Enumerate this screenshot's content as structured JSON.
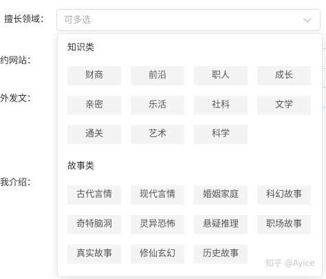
{
  "form": {
    "labels": [
      "擅长领域：",
      "约网站：",
      "外发文：",
      "我介绍："
    ],
    "select": {
      "placeholder": "可多选"
    }
  },
  "dropdown": {
    "groups": [
      {
        "title": "知识类",
        "tags": [
          "财商",
          "前沿",
          "职人",
          "成长",
          "亲密",
          "乐活",
          "社科",
          "文学",
          "通关",
          "艺术",
          "科学"
        ]
      },
      {
        "title": "故事类",
        "tags": [
          "古代言情",
          "现代言情",
          "婚姻家庭",
          "科幻故事",
          "奇特脑洞",
          "灵异恐怖",
          "悬疑推理",
          "职场故事",
          "真实故事",
          "修仙玄幻",
          "历史故事"
        ]
      }
    ]
  },
  "watermark": "知乎 @Ayice"
}
